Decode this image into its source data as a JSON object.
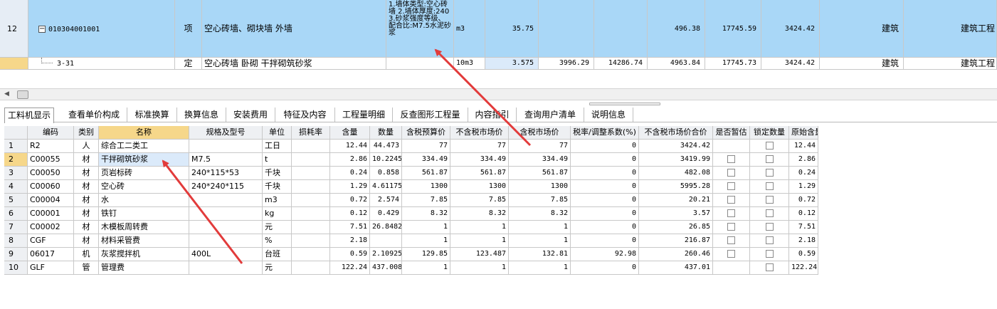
{
  "upper_grid": {
    "row1": {
      "row_no": "12",
      "expander": "−",
      "code": "010304001001",
      "type": "项",
      "name": "空心砖墙、砌块墙  外墙",
      "features": "1.墙体类型:空心砖墙 2.墙体厚度:240 3.砂浆强度等级、配合比:M7.5水泥砂浆",
      "unit": "m3",
      "qty": "35.75",
      "c1": "",
      "c2": "",
      "c3": "496.38",
      "c4": "17745.59",
      "c5": "3424.42",
      "c6": "建筑",
      "c7": "建筑工程"
    },
    "row2": {
      "row_no": "",
      "code": "3-31",
      "type": "定",
      "name": "空心砖墙 卧砌 干拌砌筑砂浆",
      "features": "",
      "unit": "10m3",
      "qty": "3.575",
      "c1": "3996.29",
      "c2": "14286.74",
      "c3": "4963.84",
      "c4": "17745.73",
      "c5": "3424.42",
      "c6": "建筑",
      "c7": "建筑工程"
    }
  },
  "scroll_arrow_icon": "triangle-left",
  "tabs": [
    "工料机显示",
    "查看单价构成",
    "标准换算",
    "换算信息",
    "安装费用",
    "特征及内容",
    "工程量明细",
    "反查图形工程量",
    "内容指引",
    "查询用户清单",
    "说明信息"
  ],
  "lower_grid": {
    "headers": [
      "编码",
      "类别",
      "名称",
      "规格及型号",
      "单位",
      "损耗率",
      "含量",
      "数量",
      "含税预算价",
      "不含税市场价",
      "含税市场价",
      "税率/调整系数(%)",
      "不含税市场价合价",
      "是否暂估",
      "锁定数量",
      "原始含量"
    ],
    "rows": [
      {
        "no": "1",
        "code": "R2",
        "cat": "人",
        "name": "综合工二类工",
        "spec": "",
        "unit": "工日",
        "loss": "",
        "content": "12.44",
        "qty": "44.473",
        "p1": "77",
        "p2": "77",
        "p3": "77",
        "rate": "0",
        "total": "3424.42",
        "est": false,
        "lock": true,
        "orig": "12.44"
      },
      {
        "no": "2",
        "code": "C00055",
        "cat": "材",
        "name": "干拌砌筑砂浆",
        "spec": "M7.5",
        "unit": "t",
        "loss": "",
        "content": "2.86",
        "qty": "10.2245",
        "p1": "334.49",
        "p2": "334.49",
        "p3": "334.49",
        "rate": "0",
        "total": "3419.99",
        "est": true,
        "lock": true,
        "orig": "2.86"
      },
      {
        "no": "3",
        "code": "C00050",
        "cat": "材",
        "name": "页岩标砖",
        "spec": "240*115*53",
        "unit": "千块",
        "loss": "",
        "content": "0.24",
        "qty": "0.858",
        "p1": "561.87",
        "p2": "561.87",
        "p3": "561.87",
        "rate": "0",
        "total": "482.08",
        "est": true,
        "lock": true,
        "orig": "0.24"
      },
      {
        "no": "4",
        "code": "C00060",
        "cat": "材",
        "name": "空心砖",
        "spec": "240*240*115",
        "unit": "千块",
        "loss": "",
        "content": "1.29",
        "qty": "4.61175",
        "p1": "1300",
        "p2": "1300",
        "p3": "1300",
        "rate": "0",
        "total": "5995.28",
        "est": true,
        "lock": true,
        "orig": "1.29"
      },
      {
        "no": "5",
        "code": "C00004",
        "cat": "材",
        "name": "水",
        "spec": "",
        "unit": "m3",
        "loss": "",
        "content": "0.72",
        "qty": "2.574",
        "p1": "7.85",
        "p2": "7.85",
        "p3": "7.85",
        "rate": "0",
        "total": "20.21",
        "est": true,
        "lock": true,
        "orig": "0.72"
      },
      {
        "no": "6",
        "code": "C00001",
        "cat": "材",
        "name": "铁钉",
        "spec": "",
        "unit": "kg",
        "loss": "",
        "content": "0.12",
        "qty": "0.429",
        "p1": "8.32",
        "p2": "8.32",
        "p3": "8.32",
        "rate": "0",
        "total": "3.57",
        "est": true,
        "lock": true,
        "orig": "0.12"
      },
      {
        "no": "7",
        "code": "C00002",
        "cat": "材",
        "name": "木模板周转费",
        "spec": "",
        "unit": "元",
        "loss": "",
        "content": "7.51",
        "qty": "26.8482",
        "p1": "1",
        "p2": "1",
        "p3": "1",
        "rate": "0",
        "total": "26.85",
        "est": true,
        "lock": true,
        "orig": "7.51"
      },
      {
        "no": "8",
        "code": "CGF",
        "cat": "材",
        "name": "材料采管费",
        "spec": "",
        "unit": "%",
        "loss": "",
        "content": "2.18",
        "qty": "",
        "p1": "1",
        "p2": "1",
        "p3": "1",
        "rate": "0",
        "total": "216.87",
        "est": true,
        "lock": true,
        "orig": "2.18"
      },
      {
        "no": "9",
        "code": "06017",
        "cat": "机",
        "name": "灰浆搅拌机",
        "spec": "400L",
        "unit": "台班",
        "loss": "",
        "content": "0.59",
        "qty": "2.10925",
        "p1": "129.85",
        "p2": "123.487",
        "p3": "132.81",
        "rate": "92.98",
        "total": "260.46",
        "est": true,
        "lock": true,
        "orig": "0.59"
      },
      {
        "no": "10",
        "code": "GLF",
        "cat": "管",
        "name": "管理费",
        "spec": "",
        "unit": "元",
        "loss": "",
        "content": "122.24",
        "qty": "437.008",
        "p1": "1",
        "p2": "1",
        "p3": "1",
        "rate": "0",
        "total": "437.01",
        "est": false,
        "lock": true,
        "orig": "122.24"
      }
    ]
  },
  "colors": {
    "selected_row": "#a9d7f7",
    "header_selected": "#f6d78a",
    "arrow": "#e23b3b"
  }
}
